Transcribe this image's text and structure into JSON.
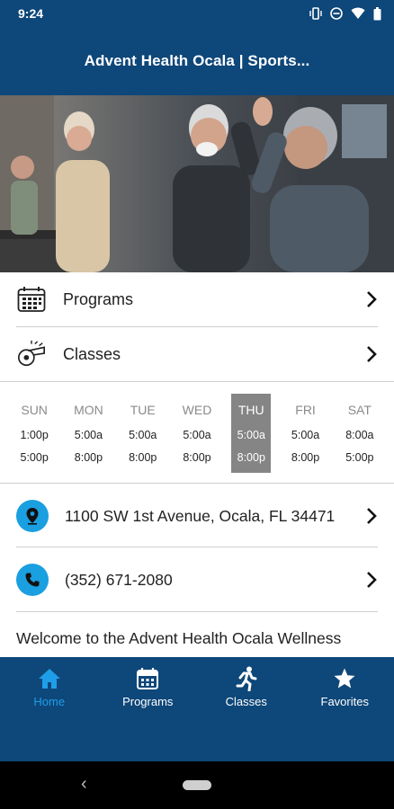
{
  "status": {
    "time": "9:24"
  },
  "header": {
    "title": "Advent Health Ocala | Sports..."
  },
  "menu": [
    {
      "label": "Programs",
      "icon": "calendar-icon"
    },
    {
      "label": "Classes",
      "icon": "whistle-icon"
    }
  ],
  "hours": [
    {
      "day": "SUN",
      "open": "1:00p",
      "close": "5:00p"
    },
    {
      "day": "MON",
      "open": "5:00a",
      "close": "8:00p"
    },
    {
      "day": "TUE",
      "open": "5:00a",
      "close": "8:00p"
    },
    {
      "day": "WED",
      "open": "5:00a",
      "close": "8:00p"
    },
    {
      "day": "THU",
      "open": "5:00a",
      "close": "8:00p",
      "active": true
    },
    {
      "day": "FRI",
      "open": "5:00a",
      "close": "8:00p"
    },
    {
      "day": "SAT",
      "open": "8:00a",
      "close": "5:00p"
    }
  ],
  "contact": {
    "address": "1100 SW 1st Avenue, Ocala, FL 34471",
    "phone": "(352) 671-2080"
  },
  "welcome_text": "Welcome to the Advent Health Ocala Wellness",
  "bottom_nav": [
    {
      "label": "Home",
      "icon": "home-icon",
      "active": true
    },
    {
      "label": "Programs",
      "icon": "calendar-icon"
    },
    {
      "label": "Classes",
      "icon": "runner-icon"
    },
    {
      "label": "Favorites",
      "icon": "star-icon"
    }
  ],
  "colors": {
    "primary": "#0e4779",
    "accent": "#1a9fe0",
    "active_day_bg": "#858585"
  }
}
